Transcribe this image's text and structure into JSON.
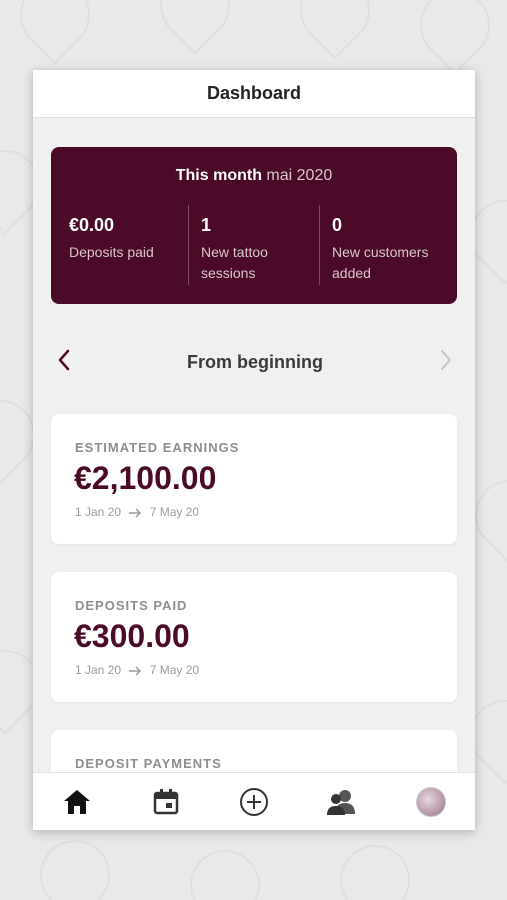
{
  "header": {
    "title": "Dashboard"
  },
  "month_card": {
    "title_strong": "This month",
    "title_light": "mai 2020",
    "stats": [
      {
        "value": "€0.00",
        "label_line1": "Deposits paid",
        "label_line2": ""
      },
      {
        "value": "1",
        "label_line1": "New tattoo",
        "label_line2": "sessions"
      },
      {
        "value": "0",
        "label_line1": "New customers",
        "label_line2": "added"
      }
    ]
  },
  "period": {
    "label": "From beginning",
    "prev_icon": "chevron-left-icon",
    "next_icon": "chevron-right-icon"
  },
  "cards": [
    {
      "title": "ESTIMATED EARNINGS",
      "value": "€2,100.00",
      "range_start": "1 Jan 20",
      "range_end": "7 May 20"
    },
    {
      "title": "DEPOSITS PAID",
      "value": "€300.00",
      "range_start": "1 Jan 20",
      "range_end": "7 May 20"
    },
    {
      "title": "DEPOSIT PAYMENTS"
    }
  ],
  "tabbar": {
    "items": [
      {
        "icon": "home-icon",
        "active": true
      },
      {
        "icon": "calendar-icon",
        "active": false
      },
      {
        "icon": "add-circle-icon",
        "active": false
      },
      {
        "icon": "customers-icon",
        "active": false
      },
      {
        "icon": "profile-avatar",
        "active": false
      }
    ]
  },
  "colors": {
    "brand": "#4a0a28",
    "muted": "#8e8e8e",
    "background": "#f0f0f0"
  }
}
